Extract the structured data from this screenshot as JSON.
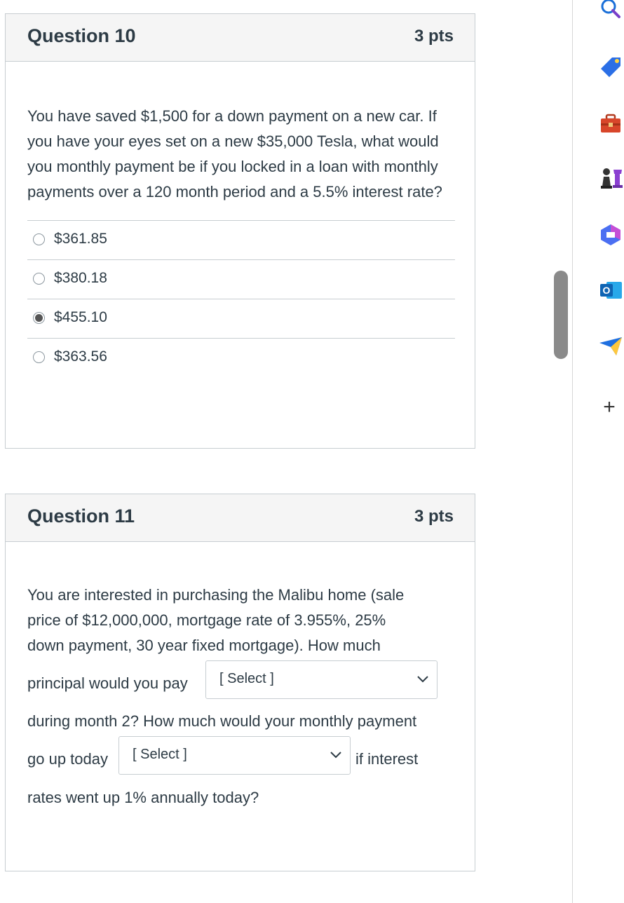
{
  "questions": [
    {
      "title": "Question 10",
      "points": "3 pts",
      "text": "You have saved $1,500 for a down payment on a new car. If you have your eyes set on a new $35,000 Tesla, what would you monthly payment be if you locked in a loan with monthly payments over a 120 month period and a 5.5% interest rate?",
      "answers": [
        {
          "label": "$361.85",
          "selected": false
        },
        {
          "label": "$380.18",
          "selected": false
        },
        {
          "label": "$455.10",
          "selected": true
        },
        {
          "label": "$363.56",
          "selected": false
        }
      ]
    },
    {
      "title": "Question 11",
      "points": "3 pts",
      "text_line1": "You are interested in purchasing the Malibu home (sale",
      "text_line2": "price of $12,000,000, mortgage rate of 3.955%, 25%",
      "text_line3": "down payment, 30 year fixed mortgage). How much",
      "text_line4": "principal would you pay",
      "text_line5": "during month 2? How much would your monthly payment",
      "text_line6a": "go up today",
      "text_line6b": "if interest",
      "text_line7": "rates went up 1% annually today?",
      "dropdown1": "[ Select ]",
      "dropdown2": "[ Select ]"
    }
  ],
  "sidebar": {
    "icons": [
      "search-icon",
      "tag-icon",
      "toolbox-icon",
      "chess-icon",
      "copilot-icon",
      "outlook-icon",
      "send-icon",
      "add-icon"
    ],
    "add_symbol": "+"
  }
}
